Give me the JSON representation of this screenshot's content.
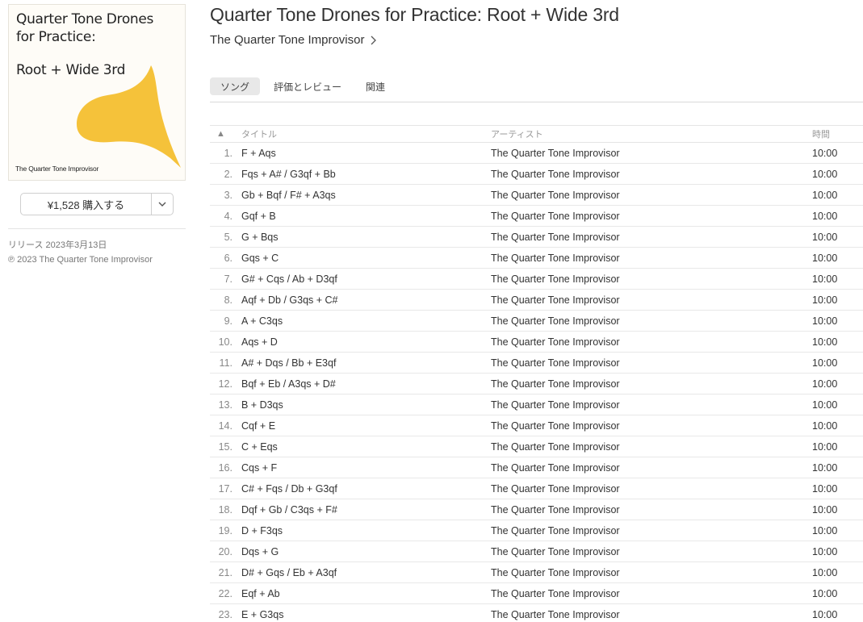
{
  "album": {
    "art": {
      "title_line1": "Quarter Tone Drones",
      "title_line2": "for Practice:",
      "subtitle": "Root + Wide 3rd",
      "artist": "The Quarter Tone Improvisor",
      "shape_color": "#F5C23A"
    },
    "title": "Quarter Tone Drones for Practice: Root + Wide 3rd",
    "artist": "The Quarter Tone Improvisor",
    "buy_label": "¥1,528 購入する",
    "release": "リリース 2023年3月13日",
    "copyright": "℗ 2023 The Quarter Tone Improvisor"
  },
  "tabs": [
    "ソング",
    "評価とレビュー",
    "関連"
  ],
  "columns": {
    "sort": "▲",
    "title": "タイトル",
    "artist": "アーティスト",
    "time": "時間"
  },
  "tracks": [
    {
      "num": "1.",
      "title": "F + Aqs",
      "artist": "The Quarter Tone Improvisor",
      "time": "10:00"
    },
    {
      "num": "2.",
      "title": "Fqs + A# / G3qf + Bb",
      "artist": "The Quarter Tone Improvisor",
      "time": "10:00"
    },
    {
      "num": "3.",
      "title": "Gb + Bqf / F# + A3qs",
      "artist": "The Quarter Tone Improvisor",
      "time": "10:00"
    },
    {
      "num": "4.",
      "title": "Gqf + B",
      "artist": "The Quarter Tone Improvisor",
      "time": "10:00"
    },
    {
      "num": "5.",
      "title": "G + Bqs",
      "artist": "The Quarter Tone Improvisor",
      "time": "10:00"
    },
    {
      "num": "6.",
      "title": "Gqs + C",
      "artist": "The Quarter Tone Improvisor",
      "time": "10:00"
    },
    {
      "num": "7.",
      "title": "G# + Cqs / Ab + D3qf",
      "artist": "The Quarter Tone Improvisor",
      "time": "10:00"
    },
    {
      "num": "8.",
      "title": "Aqf + Db / G3qs + C#",
      "artist": "The Quarter Tone Improvisor",
      "time": "10:00"
    },
    {
      "num": "9.",
      "title": "A + C3qs",
      "artist": "The Quarter Tone Improvisor",
      "time": "10:00"
    },
    {
      "num": "10.",
      "title": "Aqs + D",
      "artist": "The Quarter Tone Improvisor",
      "time": "10:00"
    },
    {
      "num": "11.",
      "title": "A# + Dqs / Bb + E3qf",
      "artist": "The Quarter Tone Improvisor",
      "time": "10:00"
    },
    {
      "num": "12.",
      "title": "Bqf + Eb / A3qs + D#",
      "artist": "The Quarter Tone Improvisor",
      "time": "10:00"
    },
    {
      "num": "13.",
      "title": "B + D3qs",
      "artist": "The Quarter Tone Improvisor",
      "time": "10:00"
    },
    {
      "num": "14.",
      "title": "Cqf + E",
      "artist": "The Quarter Tone Improvisor",
      "time": "10:00"
    },
    {
      "num": "15.",
      "title": "C + Eqs",
      "artist": "The Quarter Tone Improvisor",
      "time": "10:00"
    },
    {
      "num": "16.",
      "title": "Cqs + F",
      "artist": "The Quarter Tone Improvisor",
      "time": "10:00"
    },
    {
      "num": "17.",
      "title": "C# + Fqs / Db + G3qf",
      "artist": "The Quarter Tone Improvisor",
      "time": "10:00"
    },
    {
      "num": "18.",
      "title": "Dqf + Gb / C3qs + F#",
      "artist": "The Quarter Tone Improvisor",
      "time": "10:00"
    },
    {
      "num": "19.",
      "title": "D + F3qs",
      "artist": "The Quarter Tone Improvisor",
      "time": "10:00"
    },
    {
      "num": "20.",
      "title": "Dqs + G",
      "artist": "The Quarter Tone Improvisor",
      "time": "10:00"
    },
    {
      "num": "21.",
      "title": "D# + Gqs / Eb + A3qf",
      "artist": "The Quarter Tone Improvisor",
      "time": "10:00"
    },
    {
      "num": "22.",
      "title": "Eqf + Ab",
      "artist": "The Quarter Tone Improvisor",
      "time": "10:00"
    },
    {
      "num": "23.",
      "title": "E + G3qs",
      "artist": "The Quarter Tone Improvisor",
      "time": "10:00"
    }
  ]
}
